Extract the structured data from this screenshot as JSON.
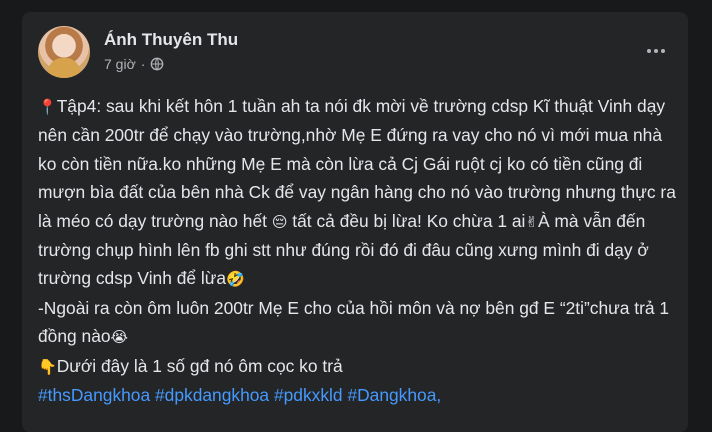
{
  "post": {
    "author_name": "Ánh Thuyên Thu",
    "time": "7 giờ",
    "separator": "·",
    "privacy_icon": "globe-icon",
    "more_icon": "more-options-icon",
    "lines": [
      {
        "emoji": "📍",
        "text": "Tập4: sau khi kết hôn 1 tuần ah ta nói đk mời về trường cdsp Kĩ thuật Vinh dạy nên cần 200tr để chạy vào trường,nhờ Mẹ E đứng ra vay cho nó vì mới mua nhà ko còn tiền nữa.ko những Mẹ E mà còn lừa cả Cj Gái ruột cj ko có tiền cũng đi mượn bìa đất của bên nhà Ck để vay ngân hàng cho nó vào trường nhưng thực ra là méo có dạy trường nào hết "
      },
      {
        "emoji_a": "😔",
        "text_a": " tất cả  đều bị lừa! Ko chừa 1 ai",
        "emoji_b": "✌",
        "text_b": "À mà vẫn đến trường chụp hình lên fb ghi stt như đúng rồi đó đi đâu cũng xưng mình đi dạy ở trường cdsp Vinh để lừa",
        "emoji_c": "🤣"
      },
      {
        "text": "-Ngoài ra còn ôm luôn 200tr Mẹ E cho của hồi môn và nợ bên gđ E “2ti”chưa trả 1 đồng nào",
        "emoji": "😭"
      },
      {
        "emoji": "👇",
        "text": "Dưới đây là 1 số gđ nó ôm cọc ko trả"
      }
    ],
    "hashtags": [
      "#thsDangkhoa",
      "#dpkdangkhoa",
      "#pdkxkld",
      "#Dangkhoa"
    ],
    "hashtag_trailing": ","
  }
}
